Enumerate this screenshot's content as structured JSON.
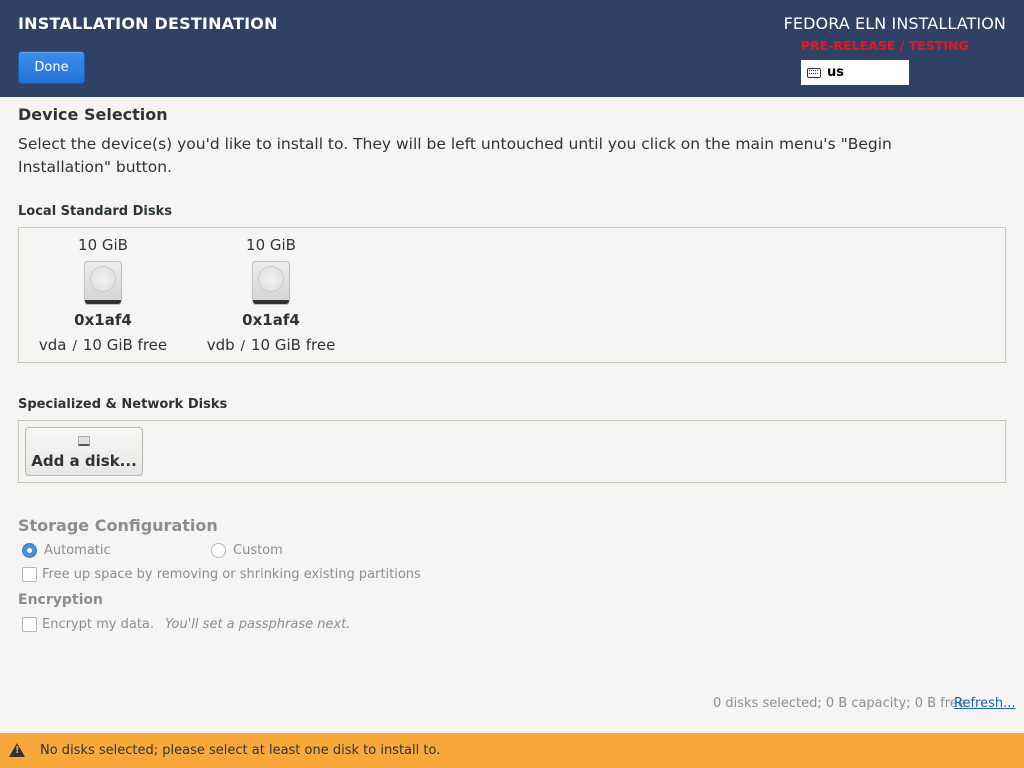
{
  "header": {
    "title": "INSTALLATION DESTINATION",
    "done_label": "Done",
    "product": "FEDORA ELN INSTALLATION",
    "prerelease": "PRE-RELEASE / TESTING",
    "keyboard_layout": "us"
  },
  "device_selection": {
    "heading": "Device Selection",
    "intro": "Select the device(s) you'd like to install to.  They will be left untouched until you click on the main menu's \"Begin Installation\" button."
  },
  "local_disks": {
    "label": "Local Standard Disks",
    "disks": [
      {
        "size": "10 GiB",
        "model": "0x1af4",
        "name": "vda",
        "separator": "/",
        "free": "10 GiB free"
      },
      {
        "size": "10 GiB",
        "model": "0x1af4",
        "name": "vdb",
        "separator": "/",
        "free": "10 GiB free"
      }
    ]
  },
  "network_disks": {
    "label": "Specialized & Network Disks",
    "add_disk_label": "Add a disk..."
  },
  "storage": {
    "heading": "Storage Configuration",
    "options": [
      {
        "label": "Automatic",
        "selected": true
      },
      {
        "label": "Custom",
        "selected": false
      }
    ],
    "free_space_label": "Free up space by removing or shrinking existing partitions"
  },
  "encryption": {
    "heading": "Encryption",
    "encrypt_label": "Encrypt my data.",
    "hint": "You'll set a passphrase next."
  },
  "footer": {
    "summary": "0 disks selected; 0 B capacity; 0 B free",
    "refresh_label": "Refresh..."
  },
  "warning": {
    "text": "No disks selected; please select at least one disk to install to.",
    "color": "#f9a93b"
  },
  "colors": {
    "header_bg": "#2f4266",
    "accent": "#2273d6",
    "prerelease": "#e8161b"
  }
}
